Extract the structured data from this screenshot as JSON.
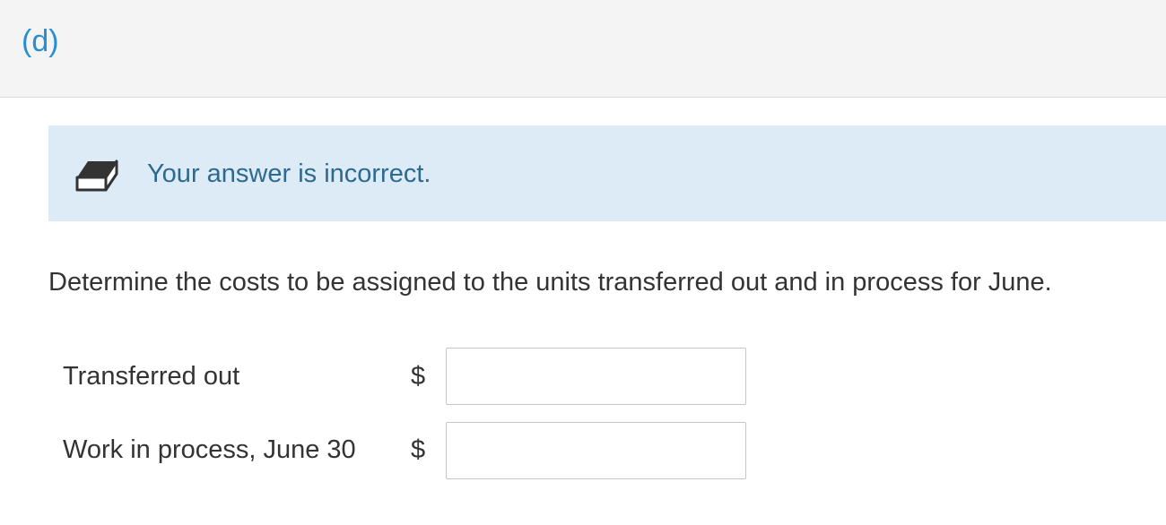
{
  "part": {
    "label": "(d)"
  },
  "feedback": {
    "icon": "eraser-icon",
    "message": "Your answer is incorrect."
  },
  "question": {
    "prompt": "Determine the costs to be assigned to the units transferred out and in process for June."
  },
  "rows": [
    {
      "label": "Transferred out",
      "currency": "$",
      "value": ""
    },
    {
      "label": "Work in process, June 30",
      "currency": "$",
      "value": ""
    }
  ],
  "colors": {
    "part_label": "#2a8fd0",
    "feedback_bg": "#dcebf5",
    "feedback_text": "#2d6a8f",
    "body_text": "#333333"
  }
}
